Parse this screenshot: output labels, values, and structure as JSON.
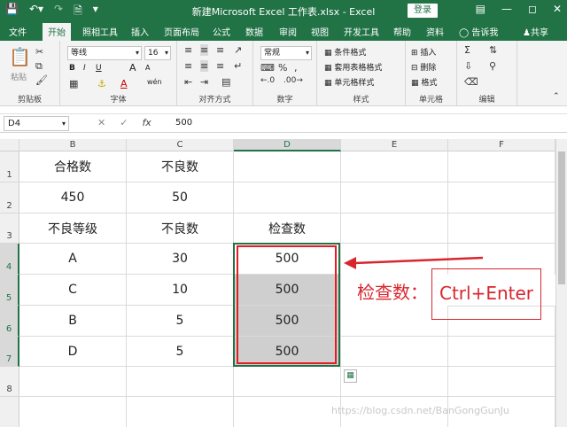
{
  "titlebar": {
    "title": "新建Microsoft Excel 工作表.xlsx  -  Excel",
    "login": "登录",
    "icons": [
      "save-icon",
      "undo-icon",
      "redo-icon",
      "new-file-icon",
      "customize-icon"
    ]
  },
  "tabs": [
    "文件",
    "开始",
    "照相工具",
    "插入",
    "页面布局",
    "公式",
    "数据",
    "审阅",
    "视图",
    "开发工具",
    "帮助",
    "资料",
    "告诉我",
    "共享"
  ],
  "active_tab": "开始",
  "ribbon": {
    "clipboard": {
      "label": "剪贴板",
      "paste": "粘贴"
    },
    "font": {
      "label": "字体",
      "name": "等线",
      "size": "16",
      "bold": "B",
      "italic": "I",
      "underline": "U",
      "grow": "A",
      "shrink": "A",
      "color_a": "A",
      "wen": "wén"
    },
    "alignment": {
      "label": "对齐方式"
    },
    "number": {
      "label": "数字",
      "format": "常规"
    },
    "styles": {
      "label": "样式",
      "items": [
        "条件格式",
        "套用表格格式",
        "单元格样式"
      ]
    },
    "cells": {
      "label": "单元格",
      "items": [
        "插入",
        "删除",
        "格式"
      ]
    },
    "editing": {
      "label": "编辑"
    }
  },
  "formula_bar": {
    "name_box": "D4",
    "fx": "fx",
    "value": "500"
  },
  "columns": [
    "B",
    "C",
    "D",
    "E",
    "F"
  ],
  "rows": [
    "1",
    "2",
    "3",
    "4",
    "5",
    "6",
    "7",
    "8"
  ],
  "cells": {
    "B1": "合格数",
    "C1": "不良数",
    "B2": "450",
    "C2": "50",
    "B3": "不良等级",
    "C3": "不良数",
    "D3": "检查数",
    "B4": "A",
    "C4": "30",
    "D4": "500",
    "B5": "C",
    "C5": "10",
    "D5": "500",
    "B6": "B",
    "C6": "5",
    "D6": "500",
    "B7": "D",
    "C7": "5",
    "D7": "500"
  },
  "annotation": {
    "label": "检查数：",
    "shortcut": "Ctrl+Enter"
  },
  "watermark": "https://blog.csdn.net/BanGongGunJu",
  "colors": {
    "excel_green": "#217346",
    "annotation_red": "#d8262e",
    "selected_gray": "#cfcfcf"
  }
}
